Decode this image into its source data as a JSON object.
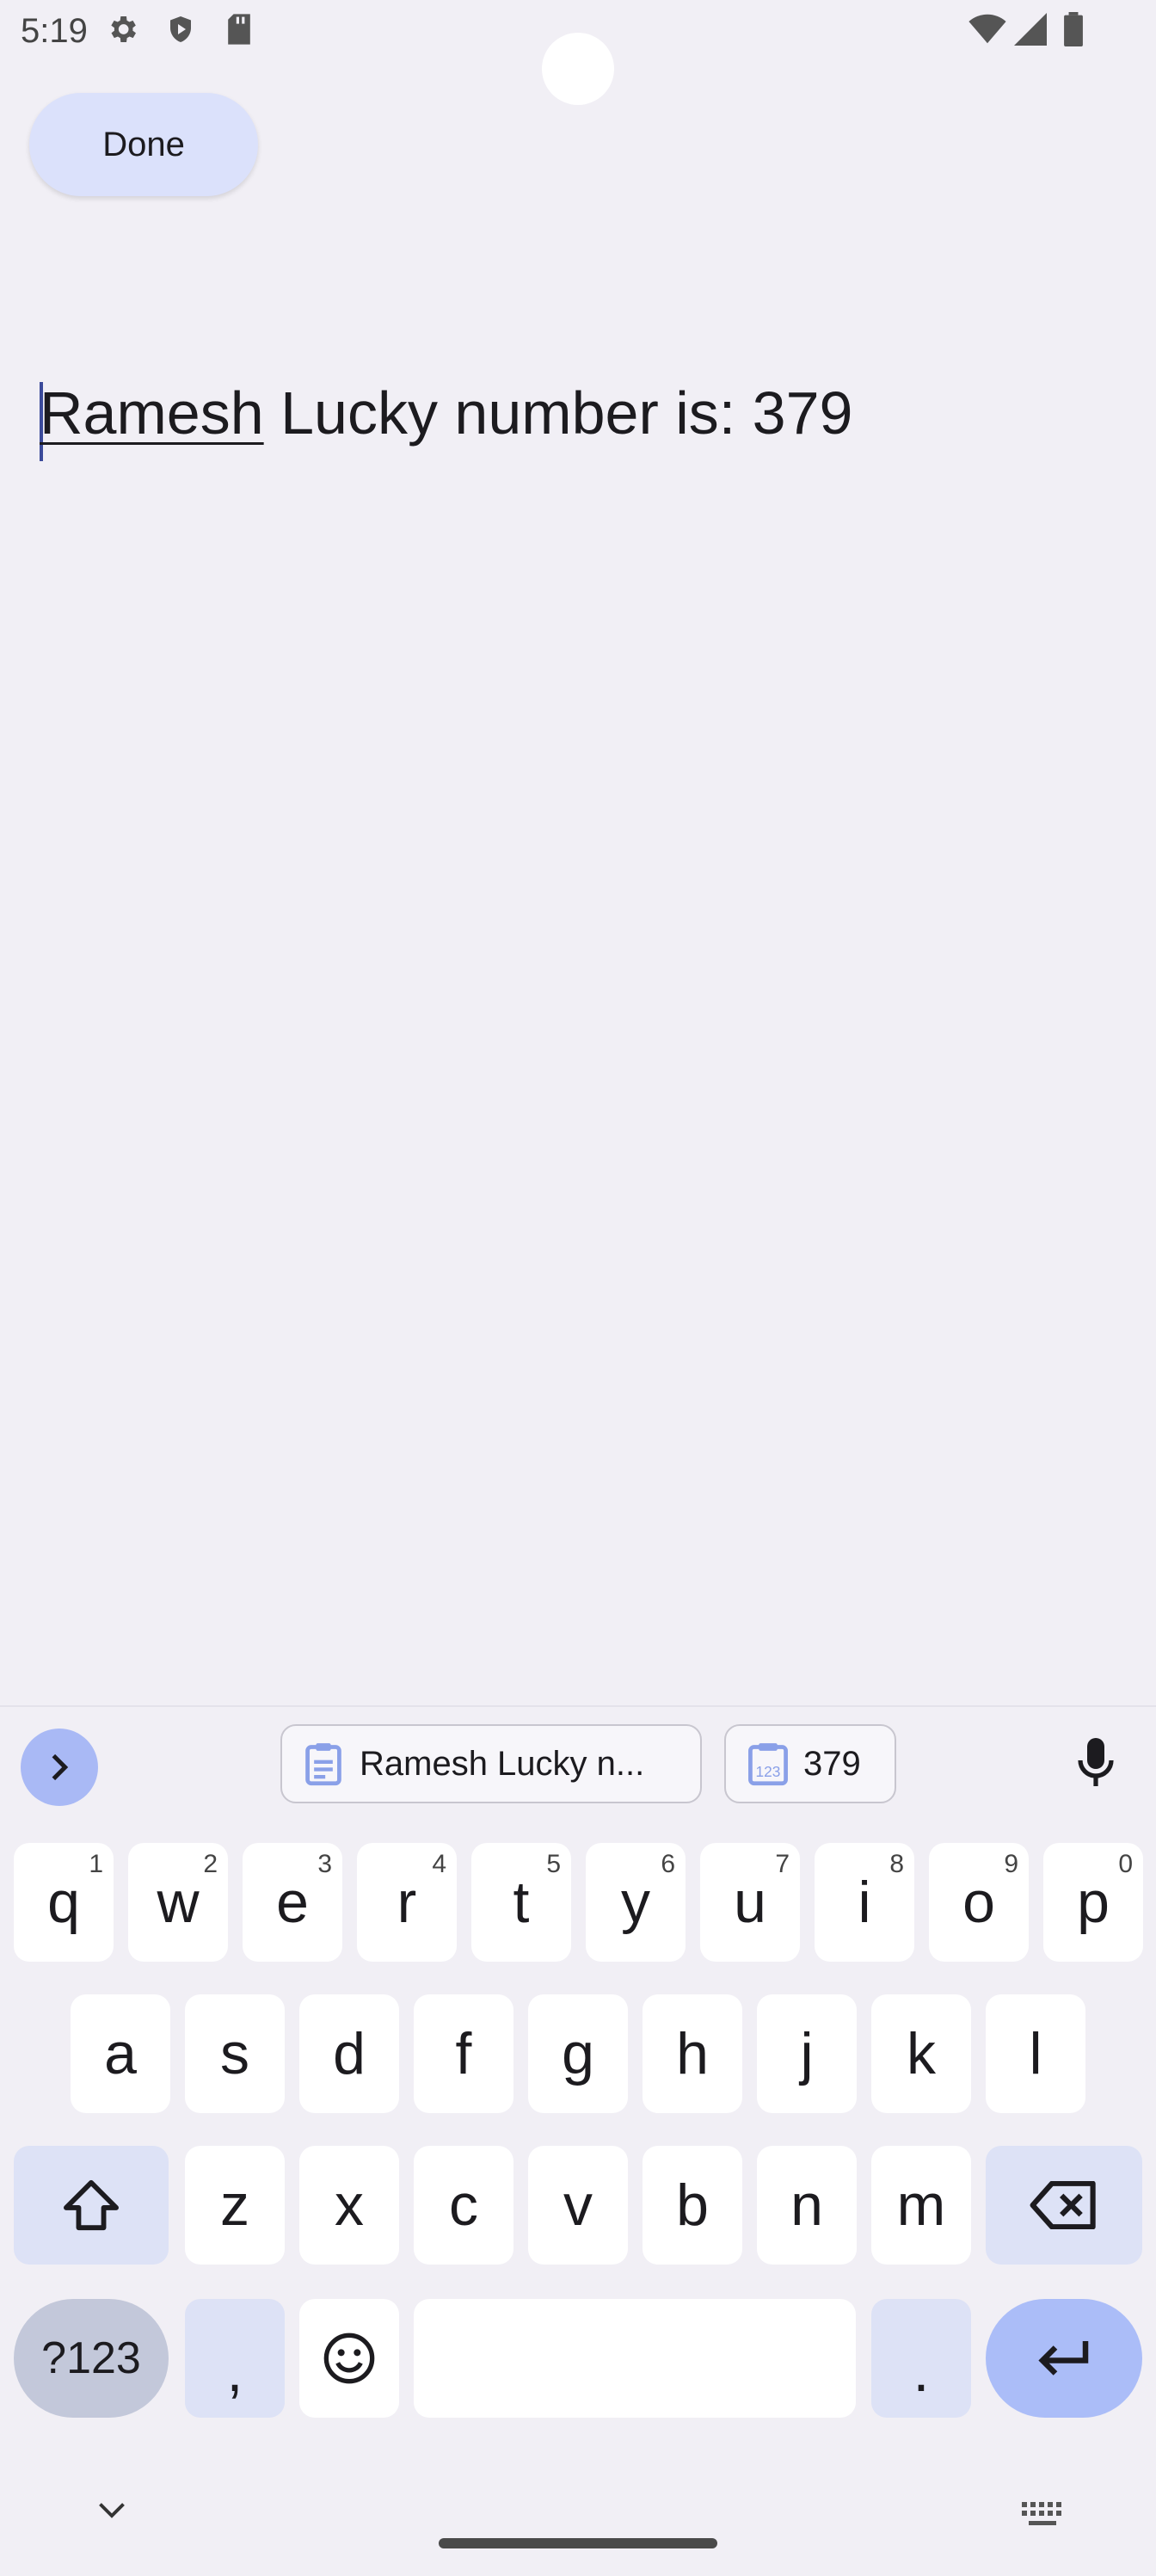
{
  "status_bar": {
    "time": "5:19",
    "left_icons": [
      "gear-icon",
      "shield-icon",
      "sd-card-icon"
    ],
    "right_icons": [
      "wifi-icon",
      "signal-icon",
      "battery-icon"
    ]
  },
  "toolbar": {
    "done_label": "Done"
  },
  "editor": {
    "underlined_word": "Ramesh",
    "rest_text": " Lucky number is: 379"
  },
  "keyboard": {
    "suggestions": [
      {
        "icon": "clipboard-icon",
        "text": "Ramesh Lucky n..."
      },
      {
        "icon": "clipboard-number-icon",
        "text": "379"
      }
    ],
    "row1": [
      {
        "k": "q",
        "h": "1"
      },
      {
        "k": "w",
        "h": "2"
      },
      {
        "k": "e",
        "h": "3"
      },
      {
        "k": "r",
        "h": "4"
      },
      {
        "k": "t",
        "h": "5"
      },
      {
        "k": "y",
        "h": "6"
      },
      {
        "k": "u",
        "h": "7"
      },
      {
        "k": "i",
        "h": "8"
      },
      {
        "k": "o",
        "h": "9"
      },
      {
        "k": "p",
        "h": "0"
      }
    ],
    "row2": [
      "a",
      "s",
      "d",
      "f",
      "g",
      "h",
      "j",
      "k",
      "l"
    ],
    "row3": [
      "z",
      "x",
      "c",
      "v",
      "b",
      "n",
      "m"
    ],
    "symbols_label": "?123",
    "comma": ",",
    "period": "."
  },
  "colors": {
    "background": "#f1eff5",
    "done_button": "#dbe1fb",
    "accent": "#abbdf8",
    "modifier_key": "#dde2f6"
  }
}
